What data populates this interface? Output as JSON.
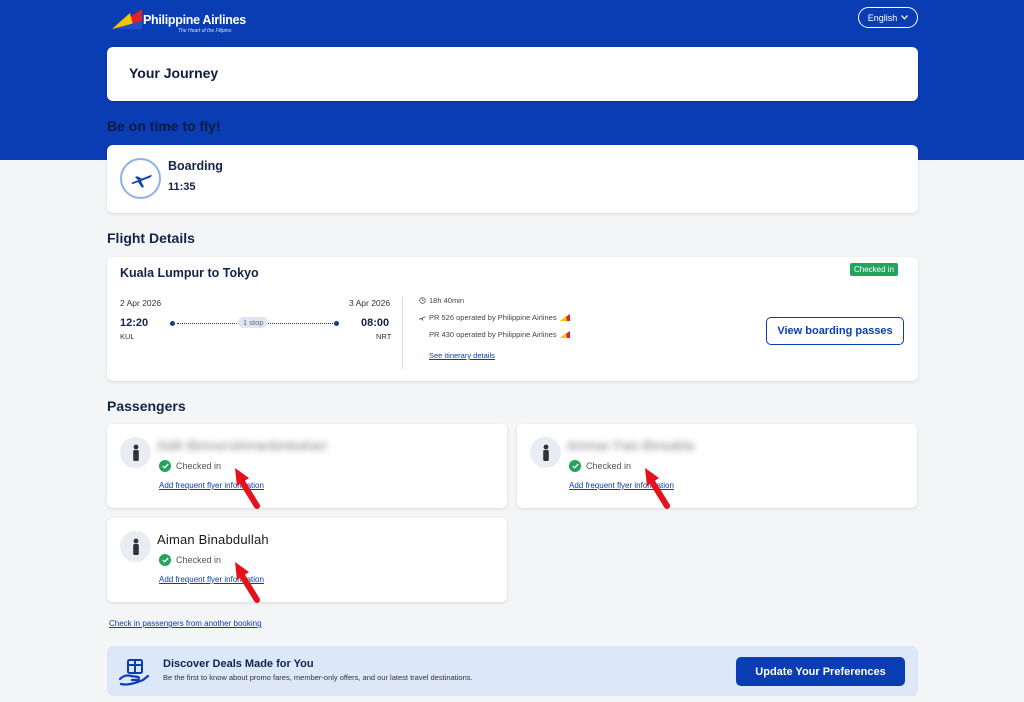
{
  "header": {
    "brand": "Philippine Airlines",
    "tagline": "The Heart of the Filipino",
    "language": "English",
    "colors": {
      "primary": "#0a3cb4",
      "success": "#22a45d",
      "flag_red": "#e0202a",
      "flag_yellow": "#f7c400"
    }
  },
  "journey": {
    "title": "Your Journey"
  },
  "boarding_section": {
    "title": "Be on time to fly!",
    "label": "Boarding",
    "time": "11:35",
    "icon": "airplane-icon"
  },
  "flight_details": {
    "title": "Flight Details",
    "route": "Kuala Lumpur to Tokyo",
    "status": "Checked in",
    "departure": {
      "date": "2 Apr 2026",
      "time": "12:20",
      "code": "KUL"
    },
    "arrival": {
      "date": "3 Apr 2026",
      "time": "08:00",
      "code": "NRT"
    },
    "stops": "1 stop",
    "duration": "18h 40min",
    "segments": [
      "PR 526 operated by Philippine Airlines",
      "PR 430 operated by Philippine Airlines"
    ],
    "itinerary_link": "See itinerary details",
    "boarding_pass_button": "View boarding passes"
  },
  "passengers": {
    "title": "Passengers",
    "list": [
      {
        "name": "Aidh Binnurrahmanbinbahari",
        "status": "Checked in",
        "link": "Add frequent flyer information"
      },
      {
        "name": "Ammar Fais Binsabla",
        "status": "Checked in",
        "link": "Add frequent flyer information"
      },
      {
        "name": "Aiman Binabdullah",
        "status": "Checked in",
        "link": "Add frequent flyer information"
      }
    ],
    "other_booking_link": "Check in passengers from another booking"
  },
  "deals": {
    "title": "Discover Deals Made for You",
    "subtitle": "Be the first to know about promo fares, member-only offers, and our latest travel destinations.",
    "button": "Update Your Preferences"
  }
}
